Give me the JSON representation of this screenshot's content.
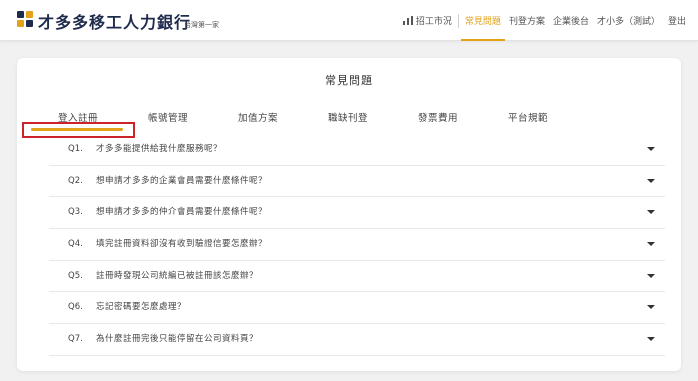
{
  "header": {
    "brand": "才多多移工人力銀行",
    "tagline": "台灣第一家",
    "nav": [
      {
        "label": "招工市況",
        "icon": "bar-chart-icon",
        "active": false
      },
      {
        "label": "常見問題",
        "active": true
      },
      {
        "label": "刊登方案",
        "active": false
      },
      {
        "label": "企業後台",
        "active": false
      },
      {
        "label": "才小多（測試）",
        "active": false
      },
      {
        "label": "登出",
        "active": false
      }
    ]
  },
  "main": {
    "title": "常見問題",
    "tabs": [
      "登入註冊",
      "帳號管理",
      "加值方案",
      "職缺刊登",
      "發票費用",
      "平台規範"
    ],
    "active_tab": 0,
    "faqs": [
      {
        "num": "Q1.",
        "question": "才多多能提供給我什麼服務呢？"
      },
      {
        "num": "Q2.",
        "question": "想申請才多多的企業會員需要什麼條件呢？"
      },
      {
        "num": "Q3.",
        "question": "想申請才多多的仲介會員需要什麼條件呢？"
      },
      {
        "num": "Q4.",
        "question": "填完註冊資料卻沒有收到驗證信要怎麼辦？"
      },
      {
        "num": "Q5.",
        "question": "註冊時發現公司統編已被註冊該怎麼辦？"
      },
      {
        "num": "Q6.",
        "question": "忘記密碼要怎麼處理？"
      },
      {
        "num": "Q7.",
        "question": "為什麼註冊完後只能停留在公司資料頁？"
      }
    ]
  },
  "colors": {
    "accent": "#e3a21a",
    "brand_dark": "#1f2b4d",
    "highlight_box": "#cc2229"
  }
}
